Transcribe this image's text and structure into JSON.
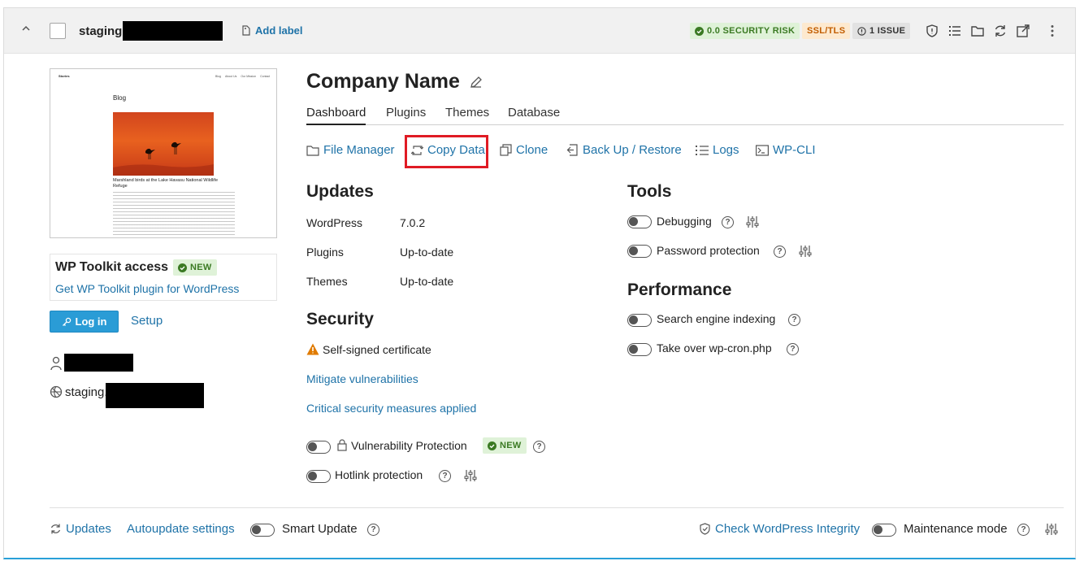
{
  "header": {
    "site_name": "staging.",
    "add_label": "Add label",
    "badges": {
      "security": "0.0 SECURITY RISK",
      "ssl": "SSL/TLS",
      "issues": "1 ISSUE"
    }
  },
  "preview": {
    "nav_brand": "Stories",
    "nav_links": [
      "Blog",
      "About Us",
      "Our Mission",
      "Contact"
    ],
    "heading": "Blog",
    "post_title": "Marshland birds at the Lake Havasu National Wildlife Refuge"
  },
  "toolkit": {
    "title": "WP Toolkit access",
    "new_badge": "NEW",
    "link": "Get WP Toolkit plugin for WordPress"
  },
  "login": {
    "button": "Log in",
    "setup": "Setup"
  },
  "domain_prefix": "staging.",
  "site": {
    "title": "Company Name",
    "tabs": [
      "Dashboard",
      "Plugins",
      "Themes",
      "Database"
    ]
  },
  "actions": {
    "file_manager": "File Manager",
    "copy_data": "Copy Data",
    "clone": "Clone",
    "backup": "Back Up / Restore",
    "logs": "Logs",
    "wpcli": "WP-CLI"
  },
  "updates": {
    "title": "Updates",
    "rows": [
      {
        "label": "WordPress",
        "value": "7.0.2"
      },
      {
        "label": "Plugins",
        "value": "Up-to-date"
      },
      {
        "label": "Themes",
        "value": "Up-to-date"
      }
    ]
  },
  "security": {
    "title": "Security",
    "certificate": "Self-signed certificate",
    "mitigate": "Mitigate vulnerabilities",
    "critical": "Critical security measures applied",
    "vuln_protection": "Vulnerability Protection",
    "new_badge": "NEW",
    "hotlink": "Hotlink protection"
  },
  "tools": {
    "title": "Tools",
    "debugging": "Debugging",
    "password": "Password protection"
  },
  "performance": {
    "title": "Performance",
    "indexing": "Search engine indexing",
    "cron": "Take over wp-cron.php"
  },
  "footer": {
    "updates": "Updates",
    "autoupdate": "Autoupdate settings",
    "smart_update": "Smart Update",
    "integrity": "Check WordPress Integrity",
    "maintenance": "Maintenance mode"
  },
  "colors": {
    "accent": "#1f73a8",
    "button": "#2a9cd6",
    "highlight": "#e01b24",
    "success": "#3b7a23",
    "warning": "#c25d00"
  }
}
